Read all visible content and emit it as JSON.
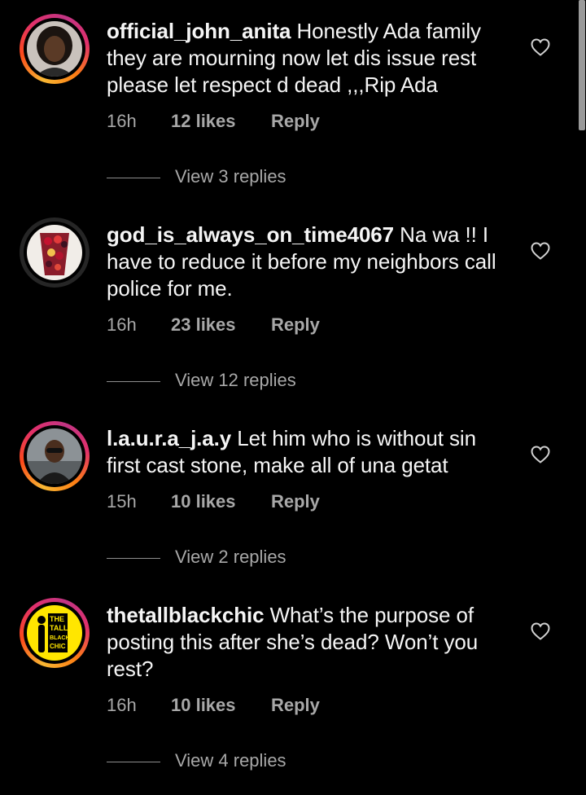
{
  "comments": [
    {
      "username": "official_john_anita",
      "text": "Honestly Ada family they are mourning now let dis issue rest please let respect d dead ,,,Rip Ada",
      "time": "16h",
      "likes": "12 likes",
      "reply": "Reply",
      "view_replies": "View 3 replies",
      "avatar": "woman-portrait",
      "story_ring": true
    },
    {
      "username": "god_is_always_on_time4067",
      "text": "Na wa !! I have to reduce it before my  neighbors call police for me.",
      "time": "16h",
      "likes": "23 likes",
      "reply": "Reply",
      "view_replies": "View 12 replies",
      "avatar": "fruit-cup",
      "story_ring": false
    },
    {
      "username": "l.a.u.r.a_j.a.y",
      "text": "Let him who is without sin first cast stone, make all of una getat",
      "time": "15h",
      "likes": "10 likes",
      "reply": "Reply",
      "view_replies": "View 2 replies",
      "avatar": "woman-sunglasses",
      "story_ring": true
    },
    {
      "username": "thetallblackchic",
      "text": "What’s the purpose of posting this after she’s dead? Won’t you rest?",
      "time": "16h",
      "likes": "10 likes",
      "reply": "Reply",
      "view_replies": "View 4 replies",
      "avatar": "tall-black-chic-logo",
      "avatar_logo_text": "THE TALL BLACK CHIC",
      "story_ring": true
    }
  ],
  "colors": {
    "background": "#000000",
    "primary_text": "#f5f5f5",
    "secondary_text": "#a8a8a8",
    "logo_yellow": "#ffe600"
  }
}
